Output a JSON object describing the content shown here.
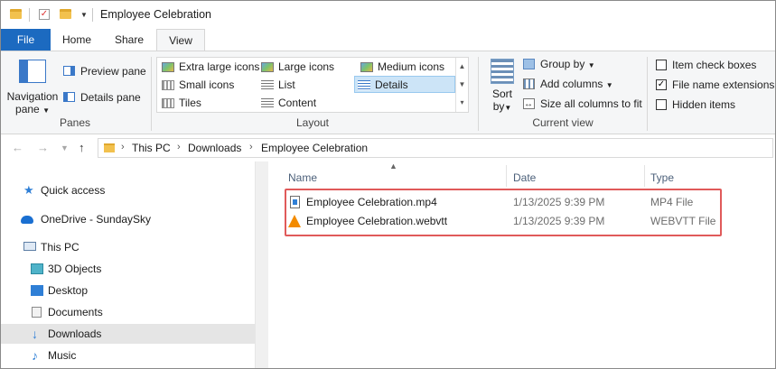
{
  "window": {
    "title": "Employee Celebration"
  },
  "colors": {
    "accent": "#1c6ac0",
    "highlight": "#e05a5a",
    "selected": "#cce4f7"
  },
  "tabs": [
    {
      "label": "File"
    },
    {
      "label": "Home"
    },
    {
      "label": "Share"
    },
    {
      "label": "View"
    }
  ],
  "ribbon": {
    "panes": {
      "group_label": "Panes",
      "navigation_pane": "Navigation",
      "navigation_pane_2": "pane",
      "preview_pane": "Preview pane",
      "details_pane": "Details pane"
    },
    "layout": {
      "group_label": "Layout",
      "items": [
        {
          "label": "Extra large icons",
          "icon": "image-large-icon"
        },
        {
          "label": "Large icons",
          "icon": "image-icon"
        },
        {
          "label": "Medium icons",
          "icon": "image-medium-icon"
        },
        {
          "label": "Small icons",
          "icon": "small-icons-icon"
        },
        {
          "label": "List",
          "icon": "list-icon"
        },
        {
          "label": "Details",
          "icon": "details-icon",
          "selected": true
        },
        {
          "label": "Tiles",
          "icon": "tiles-icon"
        },
        {
          "label": "Content",
          "icon": "content-icon"
        }
      ]
    },
    "current_view": {
      "group_label": "Current view",
      "sort_by": "Sort",
      "sort_by_2": "by",
      "group_by": "Group by",
      "add_columns": "Add columns",
      "size_columns": "Size all columns to fit"
    },
    "show_hide": {
      "item_check_boxes": {
        "label": "Item check boxes",
        "checked": false
      },
      "file_name_extensions": {
        "label": "File name extensions",
        "checked": true
      },
      "hidden_items": {
        "label": "Hidden items",
        "checked": false
      }
    }
  },
  "address": {
    "crumbs": [
      "This PC",
      "Downloads",
      "Employee Celebration"
    ]
  },
  "nav": {
    "items": [
      {
        "label": "Quick access",
        "icon": "star-icon"
      },
      {
        "label": "OneDrive - SundaySky",
        "icon": "cloud-icon"
      },
      {
        "label": "This PC",
        "icon": "computer-icon"
      },
      {
        "label": "3D Objects",
        "icon": "cube-icon"
      },
      {
        "label": "Desktop",
        "icon": "desktop-icon"
      },
      {
        "label": "Documents",
        "icon": "document-icon"
      },
      {
        "label": "Downloads",
        "icon": "download-icon",
        "selected": true
      },
      {
        "label": "Music",
        "icon": "music-icon"
      }
    ]
  },
  "files": {
    "columns": {
      "name": "Name",
      "date": "Date",
      "type": "Type"
    },
    "rows": [
      {
        "name": "Employee Celebration.mp4",
        "date": "1/13/2025 9:39 PM",
        "type": "MP4 File",
        "icon": "video-file-icon"
      },
      {
        "name": "Employee Celebration.webvtt",
        "date": "1/13/2025 9:39 PM",
        "type": "WEBVTT File",
        "icon": "vlc-cone-icon"
      }
    ]
  }
}
